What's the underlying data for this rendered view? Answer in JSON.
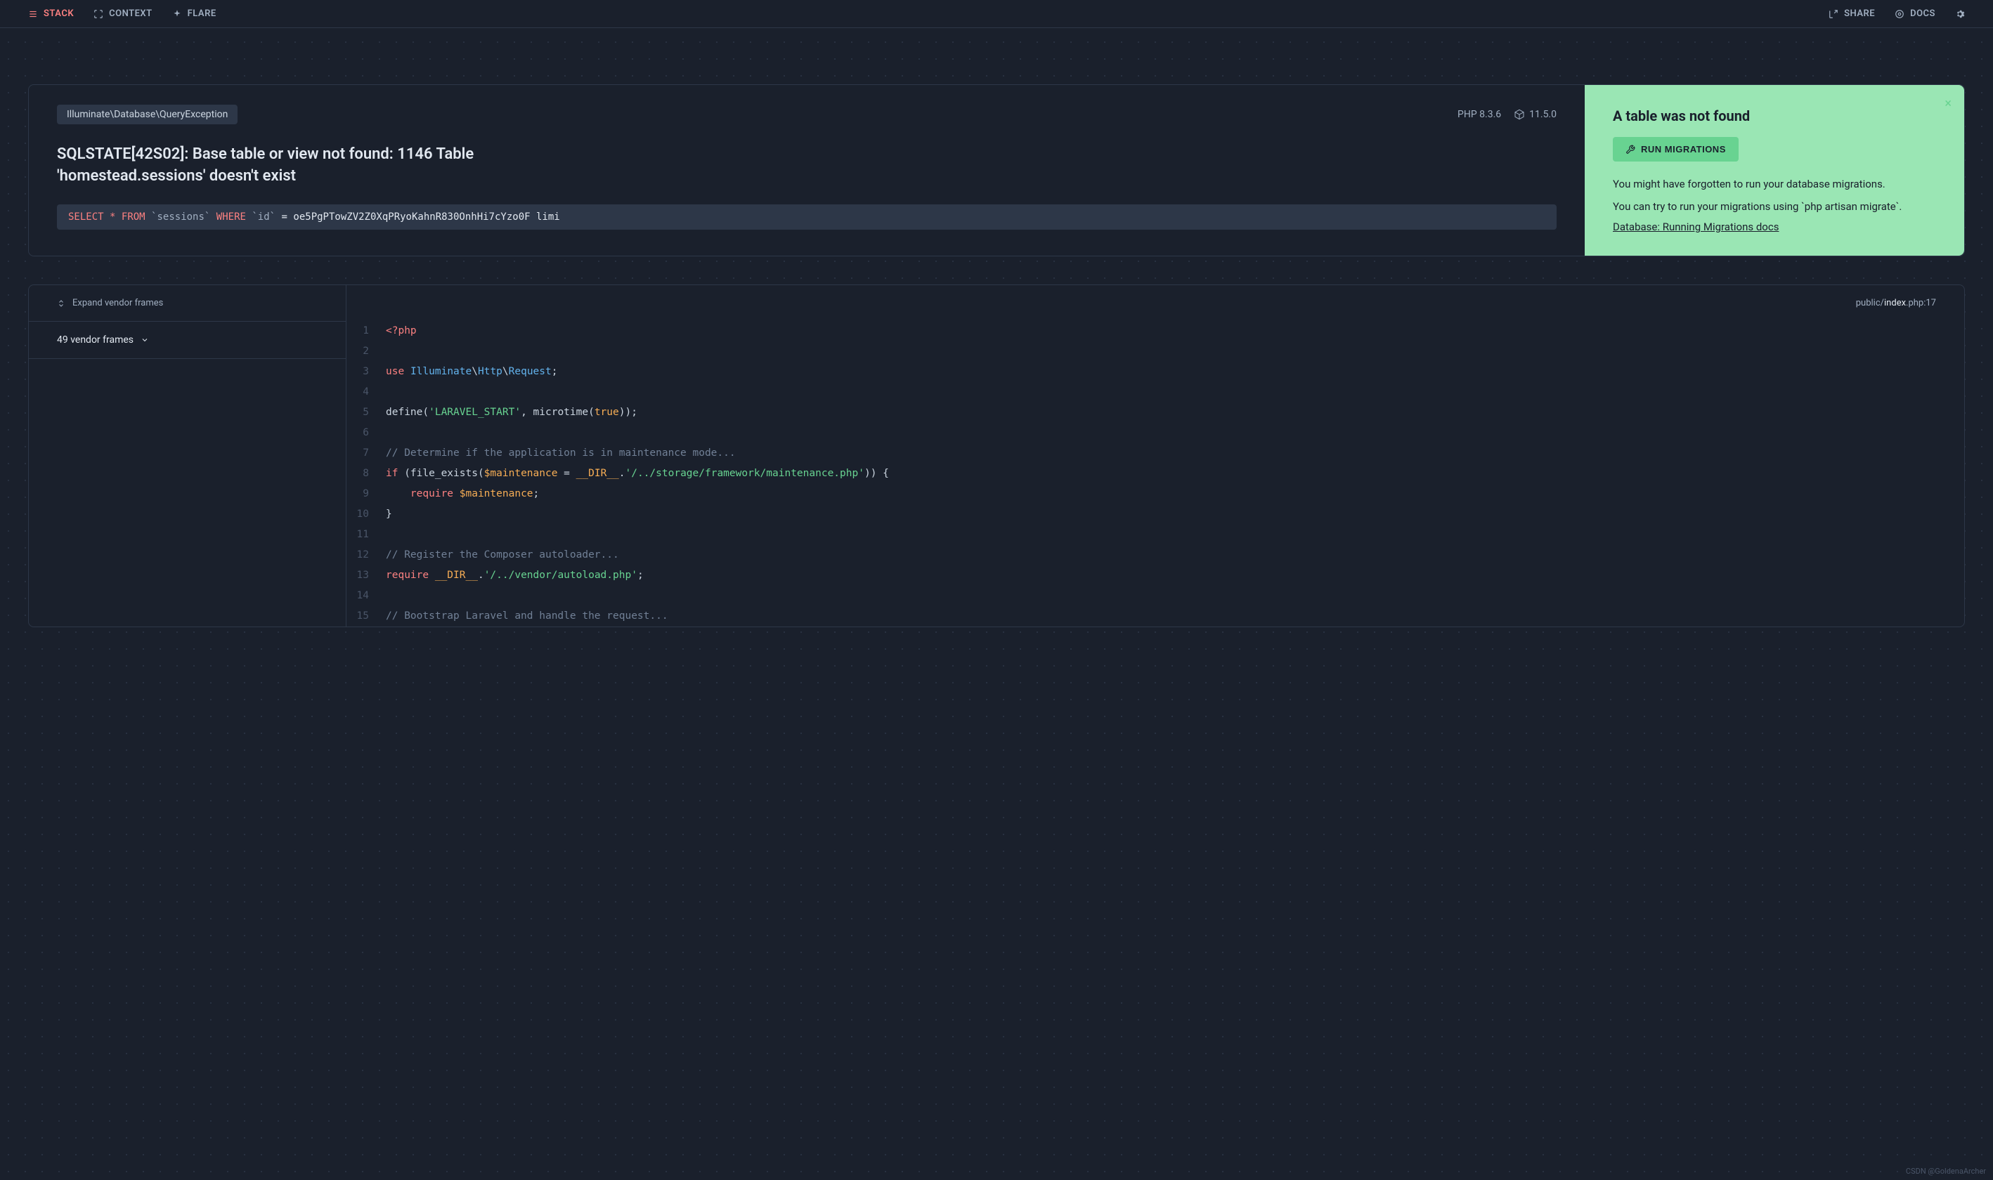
{
  "header": {
    "nav": {
      "stack": "STACK",
      "context": "CONTEXT",
      "flare": "FLARE",
      "share": "SHARE",
      "docs": "DOCS"
    }
  },
  "error": {
    "exception": "Illuminate\\Database\\QueryException",
    "php_label": "PHP",
    "php_version": "8.3.6",
    "laravel_version": "11.5.0",
    "title": "SQLSTATE[42S02]: Base table or view not found: 1146 Table 'homestead.sessions' doesn't exist",
    "sql_select": "SELECT",
    "sql_star": "*",
    "sql_from": "FROM",
    "sql_table": "`sessions`",
    "sql_where": "WHERE",
    "sql_col": "`id`",
    "sql_eq": "=",
    "sql_value": "oe5PgPTowZV2Z0XqPRyoKahnR830OnhHi7cYzo0F",
    "sql_limit": "limi"
  },
  "solution": {
    "title": "A table was not found",
    "button_label": "RUN MIGRATIONS",
    "text1": "You might have forgotten to run your database migrations.",
    "text2": "You can try to run your migrations using `php artisan migrate`.",
    "link": "Database: Running Migrations docs"
  },
  "frames": {
    "expand_label": "Expand vendor frames",
    "vendor_count": "49 vendor frames"
  },
  "file": {
    "dir": "public",
    "sep1": "/",
    "name": "index",
    "ext": ".php",
    "sep2": ":",
    "line": "17"
  },
  "watermark": "CSDN @GoldenaArcher"
}
